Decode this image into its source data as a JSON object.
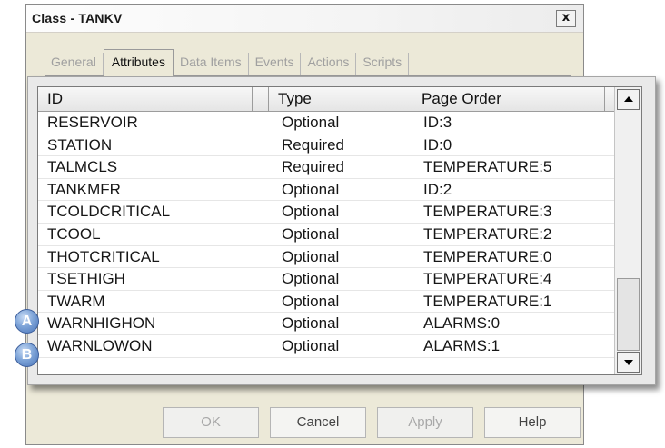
{
  "window": {
    "title": "Class - TANKV",
    "close_glyph": "x"
  },
  "tabs": [
    {
      "label": "General",
      "active": false
    },
    {
      "label": "Attributes",
      "active": true
    },
    {
      "label": "Data Items",
      "active": false
    },
    {
      "label": "Events",
      "active": false
    },
    {
      "label": "Actions",
      "active": false
    },
    {
      "label": "Scripts",
      "active": false
    }
  ],
  "table": {
    "columns": {
      "id": "ID",
      "type": "Type",
      "order": "Page Order"
    },
    "rows": [
      {
        "id": "RESERVOIR",
        "type": "Optional",
        "order": "ID:3"
      },
      {
        "id": "STATION",
        "type": "Required",
        "order": "ID:0"
      },
      {
        "id": "TALMCLS",
        "type": "Required",
        "order": "TEMPERATURE:5"
      },
      {
        "id": "TANKMFR",
        "type": "Optional",
        "order": "ID:2"
      },
      {
        "id": "TCOLDCRITICAL",
        "type": "Optional",
        "order": "TEMPERATURE:3"
      },
      {
        "id": "TCOOL",
        "type": "Optional",
        "order": "TEMPERATURE:2"
      },
      {
        "id": "THOTCRITICAL",
        "type": "Optional",
        "order": "TEMPERATURE:0"
      },
      {
        "id": "TSETHIGH",
        "type": "Optional",
        "order": "TEMPERATURE:4"
      },
      {
        "id": "TWARM",
        "type": "Optional",
        "order": "TEMPERATURE:1"
      },
      {
        "id": "WARNHIGHON",
        "type": "Optional",
        "order": "ALARMS:0"
      },
      {
        "id": "WARNLOWON",
        "type": "Optional",
        "order": "ALARMS:1"
      }
    ]
  },
  "markers": {
    "a": "A",
    "b": "B"
  },
  "buttons": {
    "ok": "OK",
    "cancel": "Cancel",
    "apply": "Apply",
    "help": "Help"
  },
  "icons": {
    "scroll_up": "arrow-up-icon",
    "scroll_down": "arrow-down-icon",
    "close": "close-icon"
  },
  "colors": {
    "dialog_bg": "#ece9d8",
    "marker_blue": "#4a74b8"
  }
}
